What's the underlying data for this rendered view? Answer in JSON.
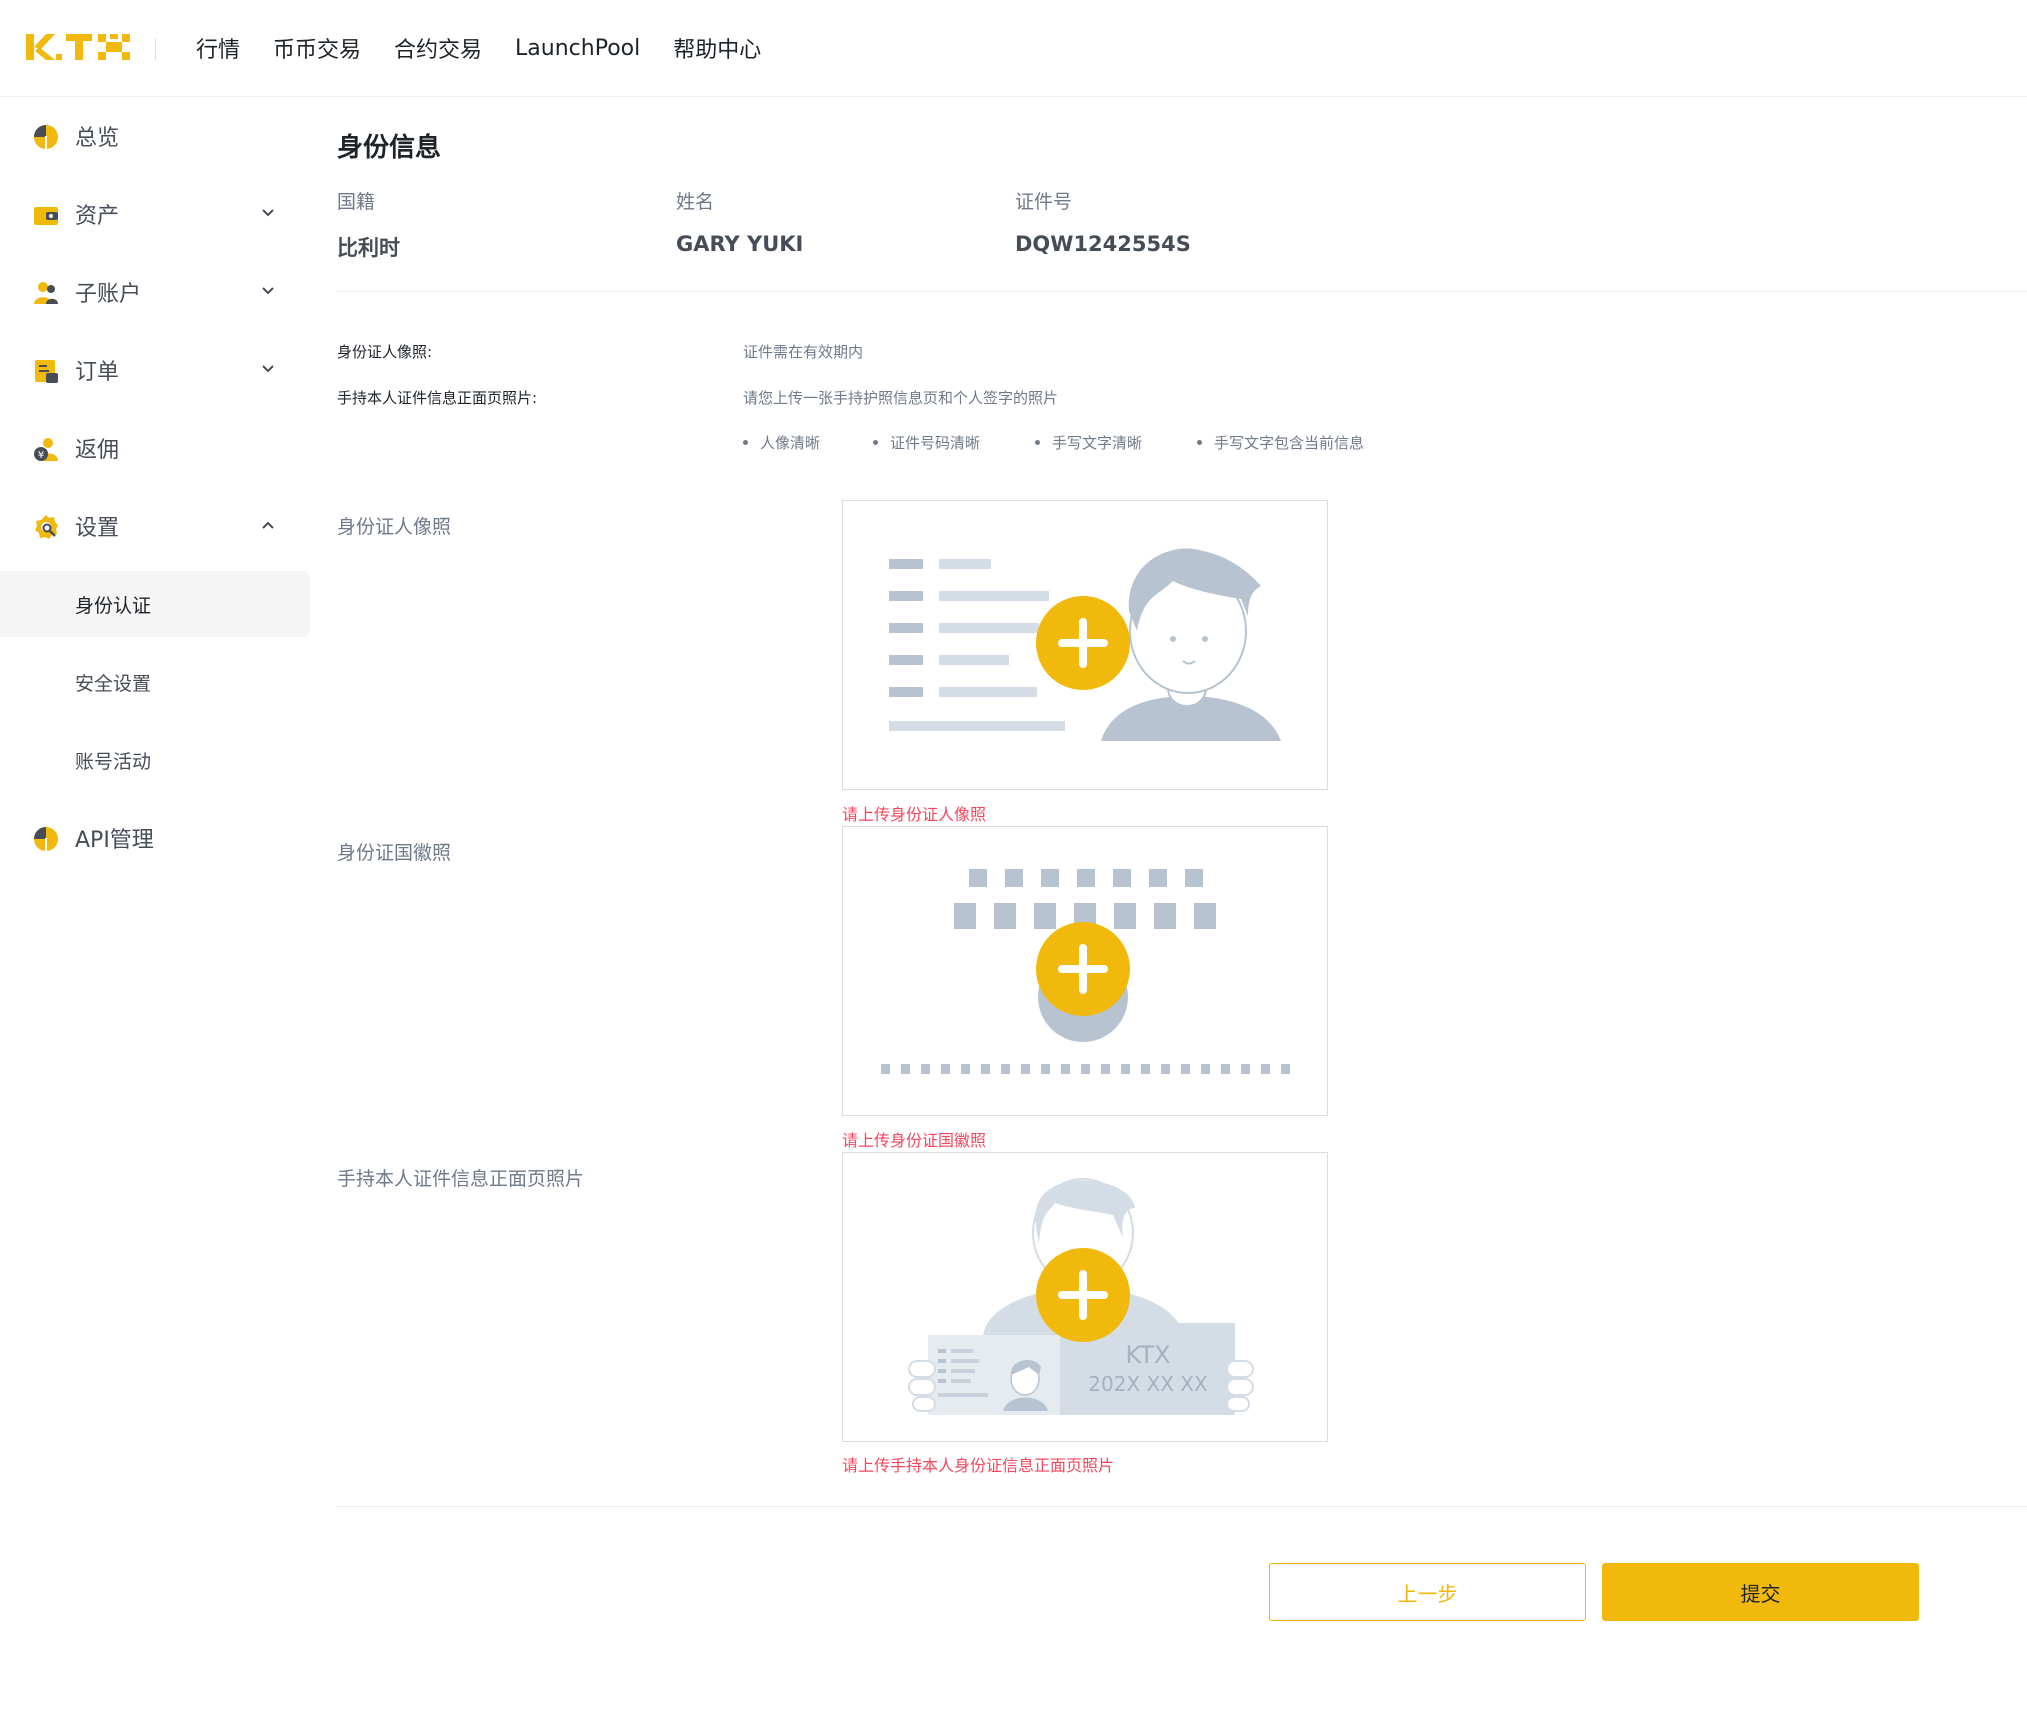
{
  "header": {
    "logo_text": "KTX",
    "nav": [
      "行情",
      "币币交易",
      "合约交易",
      "LaunchPool",
      "帮助中心"
    ]
  },
  "sidebar": {
    "items": [
      {
        "label": "总览",
        "icon": "pie-chart-icon",
        "expandable": false
      },
      {
        "label": "资产",
        "icon": "wallet-icon",
        "expandable": true
      },
      {
        "label": "子账户",
        "icon": "users-icon",
        "expandable": true
      },
      {
        "label": "订单",
        "icon": "order-icon",
        "expandable": true
      },
      {
        "label": "返佣",
        "icon": "rebate-icon",
        "expandable": false
      },
      {
        "label": "设置",
        "icon": "settings-icon",
        "expandable": true,
        "expanded": true
      }
    ],
    "settings_children": [
      "身份认证",
      "安全设置",
      "账号活动"
    ],
    "active_child": "身份认证",
    "api_item": {
      "label": "API管理",
      "icon": "api-icon"
    }
  },
  "identity": {
    "title": "身份信息",
    "nationality_label": "国籍",
    "nationality_value": "比利时",
    "name_label": "姓名",
    "name_value": "GARY YUKI",
    "id_label": "证件号",
    "id_value": "DQW1242554S"
  },
  "requirements": {
    "portrait_label": "身份证人像照:",
    "portrait_text": "证件需在有效期内",
    "handheld_label": "手持本人证件信息正面页照片:",
    "handheld_text": "请您上传一张手持护照信息页和个人签字的照片",
    "bullets": [
      "人像清晰",
      "证件号码清晰",
      "手写文字清晰",
      "手写文字包含当前信息"
    ]
  },
  "uploads": [
    {
      "label": "身份证人像照",
      "error": "请上传身份证人像照"
    },
    {
      "label": "身份证国徽照",
      "error": "请上传身份证国徽照"
    },
    {
      "label": "手持本人证件信息正面页照片",
      "error": "请上传手持本人身份证信息正面页照片",
      "card_text": "KTX",
      "card_date": "202X XX XX"
    }
  ],
  "buttons": {
    "prev": "上一步",
    "submit": "提交"
  },
  "colors": {
    "brand": "#F0B90B",
    "error": "#F6465D",
    "illustration": "#B7C3D0"
  }
}
